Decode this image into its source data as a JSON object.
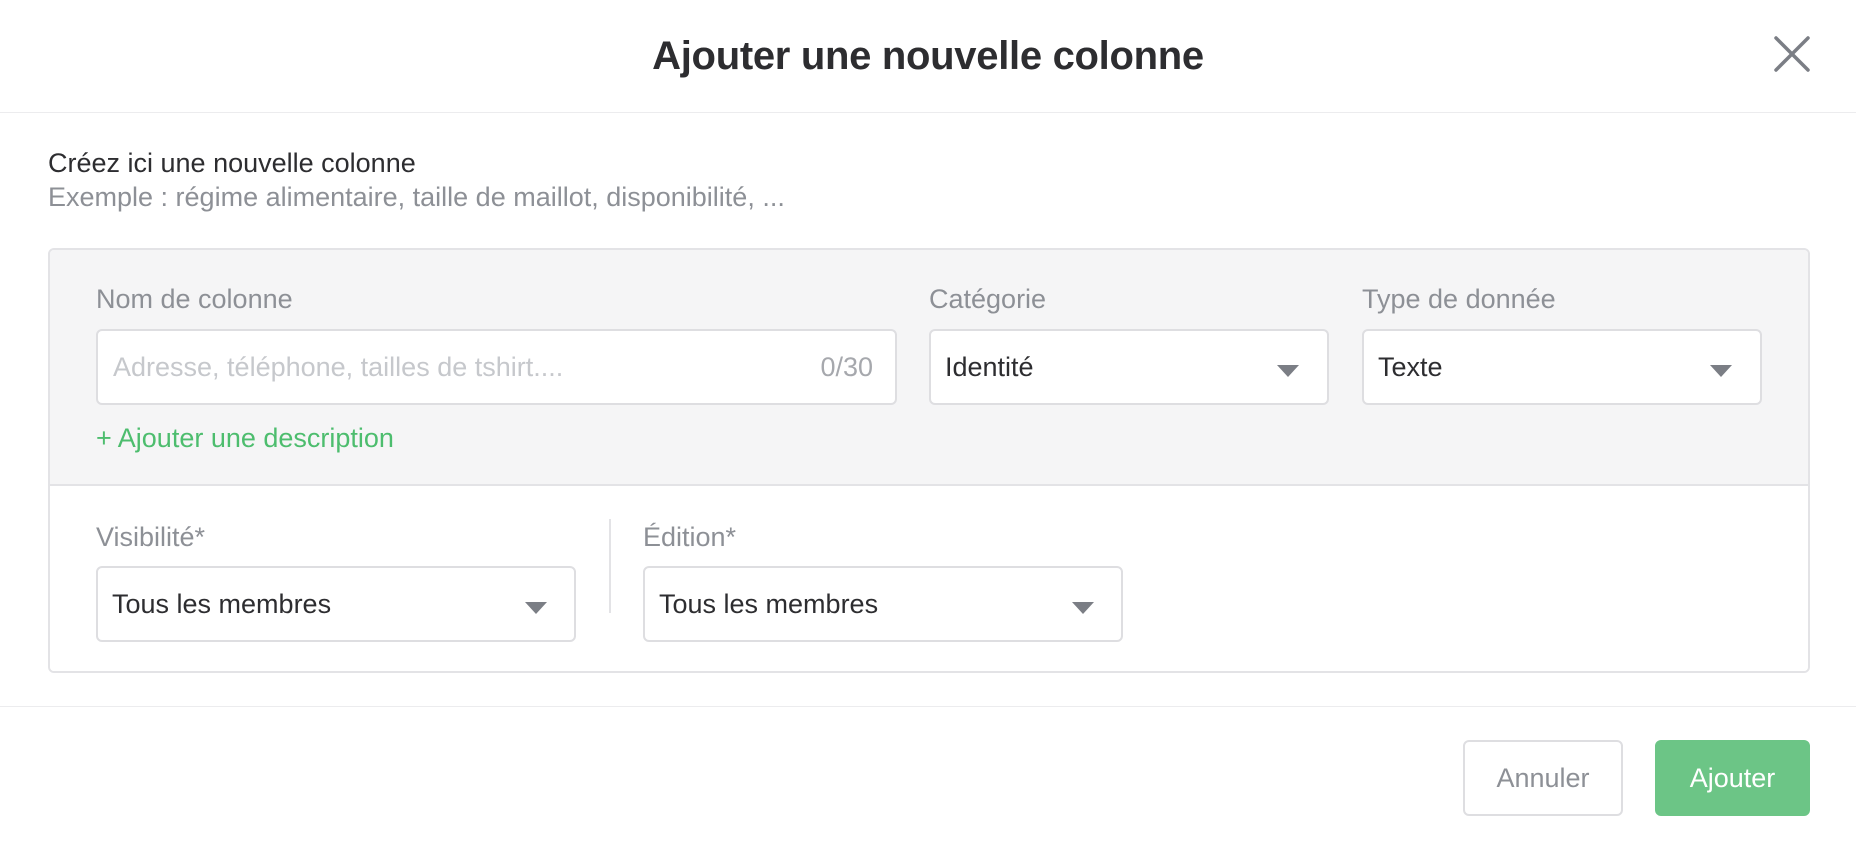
{
  "header": {
    "title": "Ajouter une nouvelle colonne",
    "close_icon": "close-icon"
  },
  "intro": {
    "title": "Créez ici une nouvelle colonne",
    "subtitle": "Exemple : régime alimentaire, taille de maillot, disponibilité, ..."
  },
  "form": {
    "column_name": {
      "label": "Nom de colonne",
      "placeholder": "Adresse, téléphone, tailles de tshirt....",
      "value": "",
      "counter": "0/30"
    },
    "category": {
      "label": "Catégorie",
      "value": "Identité",
      "icon": "chevron-down-icon"
    },
    "data_type": {
      "label": "Type de donnée",
      "value": "Texte",
      "icon": "chevron-down-icon"
    },
    "add_description": "+ Ajouter une description",
    "visibility": {
      "label": "Visibilité*",
      "value": "Tous les membres"
    },
    "edition": {
      "label": "Édition*",
      "value": "Tous les membres"
    }
  },
  "footer": {
    "cancel_label": "Annuler",
    "add_label": "Ajouter"
  },
  "colors": {
    "accent_green": "#6cc586",
    "link_green": "#4dbd6e",
    "muted_text": "#8d9096",
    "border": "#dedee1",
    "panel_bg": "#f5f5f6"
  }
}
